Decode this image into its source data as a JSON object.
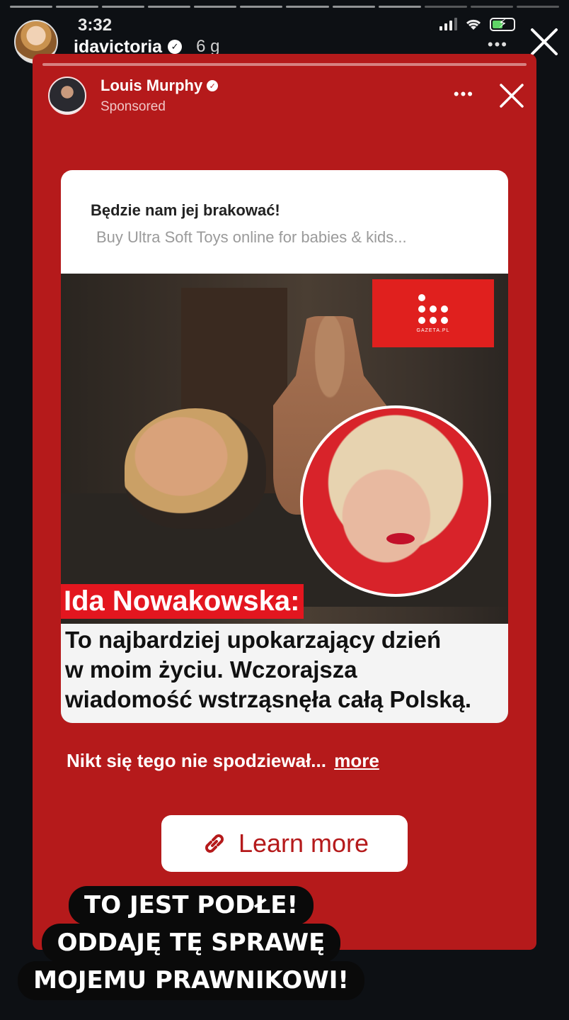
{
  "status": {
    "time": "3:32"
  },
  "story": {
    "username": "idavictoria",
    "age": "6 g",
    "more": "•••",
    "overlay_lines": [
      "TO JEST PODŁE!",
      "ODDAJĘ TĘ SPRAWĘ",
      "MOJEMU PRAWNIKOWI!"
    ]
  },
  "ad": {
    "advertiser": "Louis Murphy",
    "sponsored_label": "Sponsored",
    "more": "•••",
    "link_title": "Będzie nam jej brakować!",
    "link_subtitle": "Buy Ultra Soft Toys online for babies & kids...",
    "publisher_badge": "GAZETA.PL",
    "headline_name": "Ida Nowakowska:",
    "headline_lines": [
      "To najbardziej upokarzający dzień",
      "w moim życiu. Wczorajsza",
      "wiadomość wstrząsnęła całą Polską."
    ],
    "description": "Nikt się tego nie spodziewał...",
    "more_link": "more",
    "cta_label": "Learn more"
  },
  "colors": {
    "card_red": "#b51a1b",
    "headline_red": "#e3161f",
    "background": "#0d1014"
  }
}
